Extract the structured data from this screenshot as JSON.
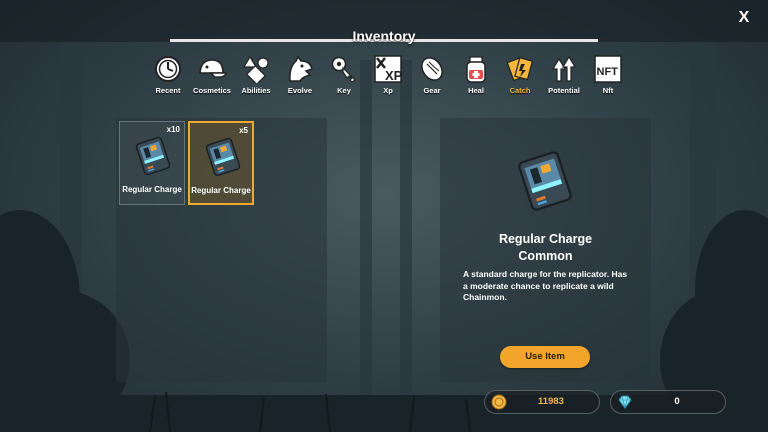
{
  "header": {
    "title": "Inventory",
    "close_label": "X"
  },
  "tabs": [
    {
      "label": "Recent",
      "icon": "clock-icon",
      "active": false
    },
    {
      "label": "Cosmetics",
      "icon": "cap-icon",
      "active": false
    },
    {
      "label": "Abilities",
      "icon": "abilities-icon",
      "active": false
    },
    {
      "label": "Evolve",
      "icon": "dragon-head-icon",
      "active": false
    },
    {
      "label": "Key",
      "icon": "key-icon",
      "active": false
    },
    {
      "label": "Xp",
      "icon": "xp-icon",
      "active": false
    },
    {
      "label": "Gear",
      "icon": "gear-icon",
      "active": false
    },
    {
      "label": "Heal",
      "icon": "potion-jar-icon",
      "active": false
    },
    {
      "label": "Catch",
      "icon": "charge-card-icon",
      "active": true
    },
    {
      "label": "Potential",
      "icon": "arrows-up-icon",
      "active": false
    },
    {
      "label": "Nft",
      "icon": "nft-icon",
      "active": false
    }
  ],
  "items": [
    {
      "name": "Regular Charge",
      "count": "x10",
      "selected": false
    },
    {
      "name": "Regular Charge",
      "count": "x5",
      "selected": true
    }
  ],
  "detail": {
    "name": "Regular Charge",
    "rarity": "Common",
    "description": "A standard charge for the replicator. Has a moderate chance to replicate a wild Chainmon.",
    "use_button": "Use Item"
  },
  "currency": {
    "coins": "11983",
    "gems": "0"
  },
  "colors": {
    "accent": "#f2a52a",
    "active_tab": "#f4b63c"
  }
}
